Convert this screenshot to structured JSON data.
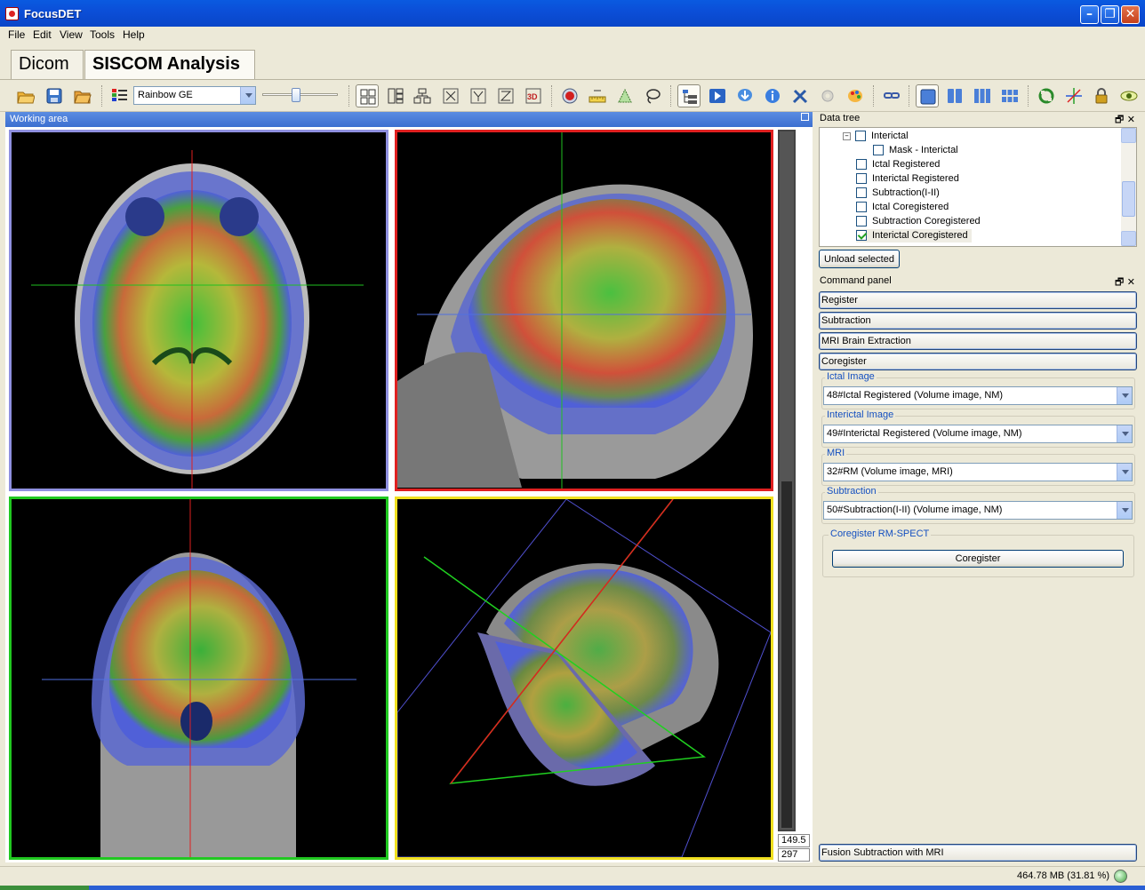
{
  "window": {
    "title": "FocusDET"
  },
  "menu": [
    "File",
    "Edit",
    "View",
    "Tools",
    "Help"
  ],
  "tabs": [
    {
      "label": "Dicom"
    },
    {
      "label": "SISCOM Analysis"
    }
  ],
  "toolbar": {
    "palette": "Rainbow GE"
  },
  "working_area": {
    "title": "Working area",
    "slice_value": "149.5",
    "slice_index": "297"
  },
  "data_tree": {
    "title": "Data tree",
    "items": [
      {
        "label": "Interictal",
        "checked": false
      },
      {
        "label": "Mask - Interictal",
        "checked": false
      },
      {
        "label": "Ictal Registered",
        "checked": false
      },
      {
        "label": "Interictal Registered",
        "checked": false
      },
      {
        "label": "Subtraction(I-II)",
        "checked": false
      },
      {
        "label": "Ictal Coregistered",
        "checked": false
      },
      {
        "label": "Subtraction Coregistered",
        "checked": false
      },
      {
        "label": "Interictal Coregistered",
        "checked": true
      }
    ],
    "unload_label": "Unload selected"
  },
  "command_panel": {
    "title": "Command panel",
    "buttons": [
      "Register",
      "Subtraction",
      "MRI Brain Extraction",
      "Coregister"
    ],
    "fields": [
      {
        "label": "Ictal Image",
        "value": "48#Ictal Registered (Volume image, NM)"
      },
      {
        "label": "Interictal Image",
        "value": "49#Interictal Registered (Volume image, NM)"
      },
      {
        "label": "MRI",
        "value": "32#RM (Volume image, MRI)"
      },
      {
        "label": "Subtraction",
        "value": "50#Subtraction(I-II) (Volume image, NM)"
      }
    ],
    "coregister_group": "Coregister RM-SPECT",
    "coregister_button": "Coregister",
    "fusion_button": "Fusion Subtraction with MRI"
  },
  "status": {
    "memory": "464.78 MB (31.81 %)"
  }
}
